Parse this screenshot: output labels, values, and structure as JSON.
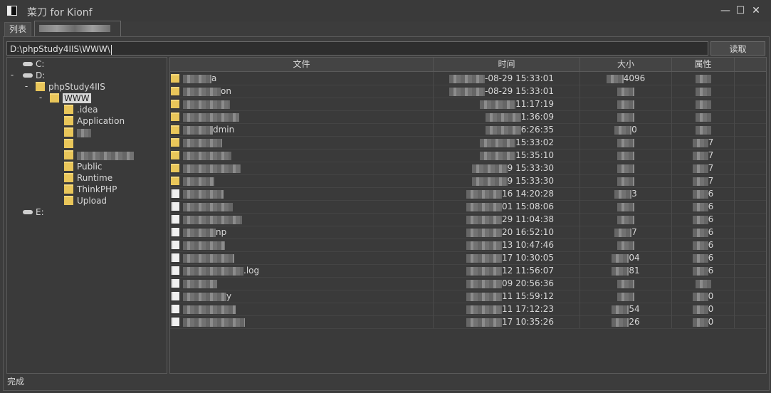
{
  "window": {
    "title": "菜刀 for Kionf",
    "minimize_glyph": "—",
    "maximize_glyph": "☐",
    "close_glyph": "✕"
  },
  "tabs": [
    {
      "label": "列表"
    },
    {
      "label": ""
    }
  ],
  "path": {
    "value": "D:\\phpStudy4IIS\\WWW\\"
  },
  "read_button": "读取",
  "tree": [
    {
      "label": "C:",
      "type": "drive",
      "expanded": false
    },
    {
      "label": "D:",
      "type": "drive",
      "expanded": true
    },
    {
      "label": "phpStudy4IIS",
      "type": "folder",
      "expanded": true
    },
    {
      "label": "WWW",
      "type": "folder",
      "expanded": true,
      "selected": true
    },
    {
      "label": ".idea",
      "type": "folder"
    },
    {
      "label": "Application",
      "type": "folder"
    },
    {
      "label": "",
      "type": "folder"
    },
    {
      "label": "",
      "type": "folder"
    },
    {
      "label": "",
      "type": "folder"
    },
    {
      "label": "Public",
      "type": "folder"
    },
    {
      "label": "Runtime",
      "type": "folder"
    },
    {
      "label": "ThinkPHP",
      "type": "folder"
    },
    {
      "label": "Upload",
      "type": "folder"
    },
    {
      "label": "E:",
      "type": "drive",
      "expanded": false
    }
  ],
  "columns": {
    "name": "文件",
    "time": "时间",
    "size": "大小",
    "attr": "属性"
  },
  "files": [
    {
      "icon": "folder",
      "name": "a",
      "time": "-08-29 15:33:01",
      "size": "4096",
      "attr": ""
    },
    {
      "icon": "folder",
      "name": "on",
      "time": "-08-29 15:33:01",
      "size": "",
      "attr": ""
    },
    {
      "icon": "folder",
      "name": "",
      "time": "11:17:19",
      "size": "",
      "attr": ""
    },
    {
      "icon": "folder",
      "name": "",
      "time": "1:36:09",
      "size": "",
      "attr": ""
    },
    {
      "icon": "folder",
      "name": "dmin",
      "time": "6:26:35",
      "size": "0",
      "attr": ""
    },
    {
      "icon": "folder",
      "name": "",
      "time": "15:33:02",
      "size": "",
      "attr": "7"
    },
    {
      "icon": "folder",
      "name": "",
      "time": "15:35:10",
      "size": "",
      "attr": "7"
    },
    {
      "icon": "folder",
      "name": "",
      "time": "9 15:33:30",
      "size": "",
      "attr": "7"
    },
    {
      "icon": "folder",
      "name": "",
      "time": "9 15:33:30",
      "size": "",
      "attr": "7"
    },
    {
      "icon": "file",
      "name": "",
      "time": "16 14:20:28",
      "size": "3",
      "attr": "6"
    },
    {
      "icon": "file",
      "name": "",
      "time": "01 15:08:06",
      "size": "",
      "attr": "6"
    },
    {
      "icon": "file",
      "name": "",
      "time": "29 11:04:38",
      "size": "",
      "attr": "6"
    },
    {
      "icon": "file",
      "name": "np",
      "time": "20 16:52:10",
      "size": "7",
      "attr": "6"
    },
    {
      "icon": "file",
      "name": "",
      "time": "13 10:47:46",
      "size": "",
      "attr": "6"
    },
    {
      "icon": "file",
      "name": "",
      "time": "17 10:30:05",
      "size": "04",
      "attr": "6"
    },
    {
      "icon": "file",
      "name": ".log",
      "time": "12 11:56:07",
      "size": "81",
      "attr": "6"
    },
    {
      "icon": "file",
      "name": "",
      "time": "09 20:56:36",
      "size": "",
      "attr": ""
    },
    {
      "icon": "file",
      "name": "y",
      "time": "11 15:59:12",
      "size": "",
      "attr": "0"
    },
    {
      "icon": "file",
      "name": "",
      "time": "11 17:12:23",
      "size": "54",
      "attr": "0"
    },
    {
      "icon": "file",
      "name": "",
      "time": "17 10:35:26",
      "size": "26",
      "attr": "0"
    }
  ],
  "status": "完成"
}
